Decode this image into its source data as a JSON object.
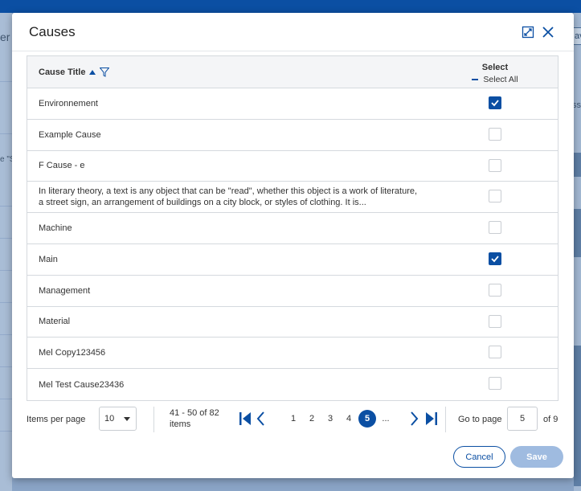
{
  "background": {
    "left_fragment_1": "er",
    "left_fragment_2": "e \"S",
    "right_fragment_1": "ave",
    "right_fragment_2": "ss"
  },
  "modal": {
    "title": "Causes",
    "expand_icon": "expand-icon",
    "close_icon": "close-icon"
  },
  "table": {
    "col_title": "Cause Title",
    "col_select": "Select",
    "select_all": "Select All",
    "rows": [
      {
        "title": "Environnement",
        "checked": true
      },
      {
        "title": "Example Cause",
        "checked": false
      },
      {
        "title": "F Cause - e",
        "checked": false
      },
      {
        "title": "In literary theory, a text is any object that can be \"read\", whether this object is a work of literature, a street sign, an arrangement of buildings on a city block, or styles of clothing. It is...",
        "checked": false
      },
      {
        "title": "Machine",
        "checked": false
      },
      {
        "title": "Main",
        "checked": true
      },
      {
        "title": "Management",
        "checked": false
      },
      {
        "title": "Material",
        "checked": false
      },
      {
        "title": "Mel Copy123456",
        "checked": false
      },
      {
        "title": "Mel Test Cause23436",
        "checked": false
      }
    ]
  },
  "pager": {
    "items_per_page_label": "Items per page",
    "items_per_page_value": "10",
    "range_text": "41 - 50 of 82 items",
    "pages": [
      "1",
      "2",
      "3",
      "4",
      "5",
      "..."
    ],
    "current_page": "5",
    "goto_label": "Go to page",
    "goto_value": "5",
    "of_total": "of 9"
  },
  "buttons": {
    "cancel": "Cancel",
    "save": "Save"
  },
  "colors": {
    "accent": "#0b4fa3",
    "save_disabled": "#9fbbe0"
  }
}
